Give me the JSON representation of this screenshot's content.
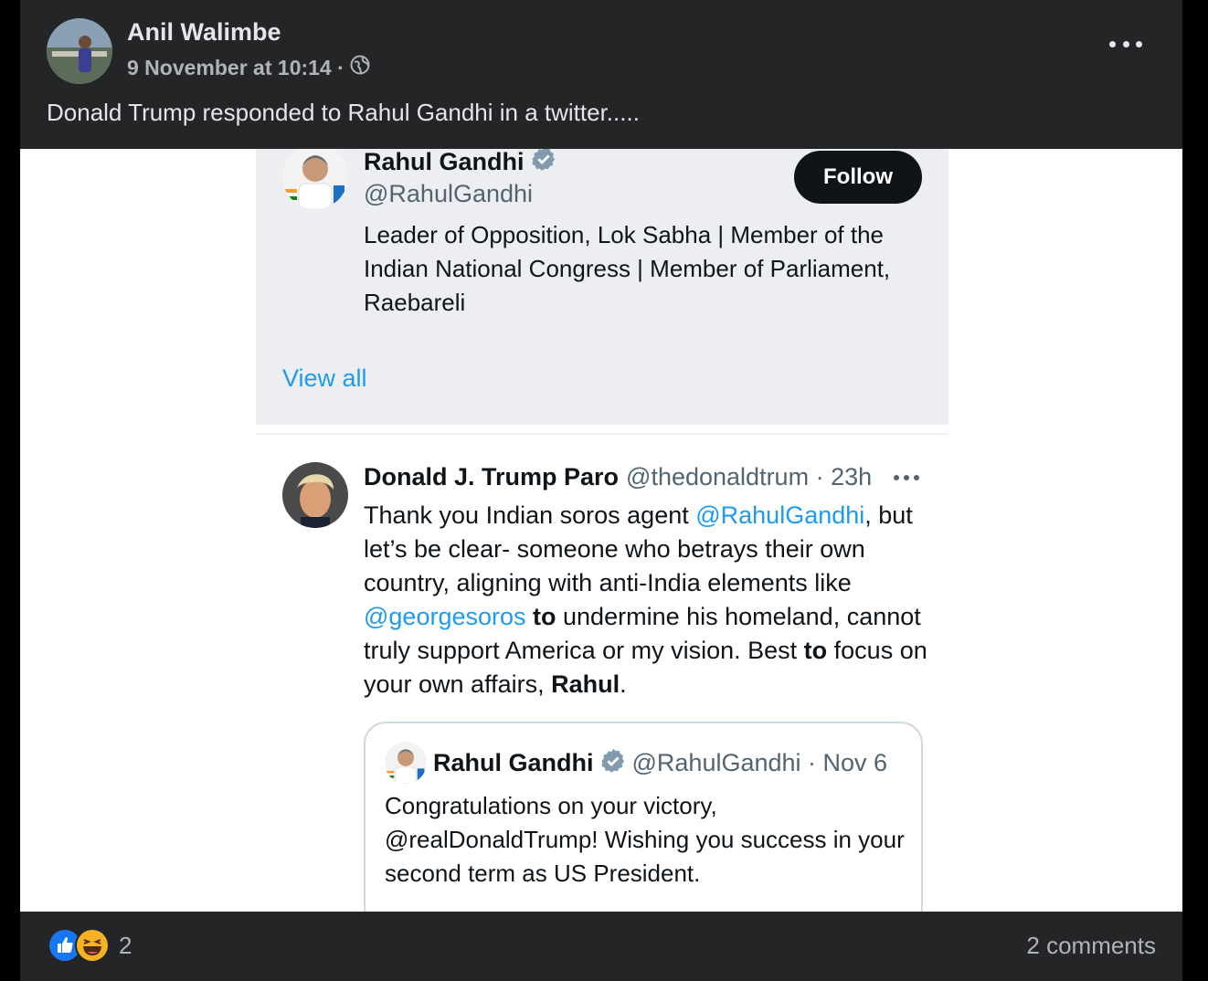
{
  "post": {
    "author": "Anil Walimbe",
    "timestamp": "9 November at 10:14 ·",
    "audience_icon": "globe-icon",
    "text": "Donald Trump responded to Rahul Gandhi in a twitter....."
  },
  "profile_card": {
    "name": "Rahul Gandhi",
    "handle": "@RahulGandhi",
    "follow_label": "Follow",
    "bio": "Leader of Opposition, Lok Sabha | Member of the Indian National Congress | Member of Parliament, Raebareli",
    "view_all": "View all"
  },
  "tweet": {
    "name": "Donald J. Trump Paro",
    "handle_time": "@thedonaldtrum · 23h",
    "body": {
      "p1": "Thank you Indian soros agent ",
      "m1": "@RahulGandhi",
      "p2": ", but let’s be clear- someone who betrays their own country, aligning with anti-India elements like ",
      "m2": "@georgesoros",
      "b1": " to",
      "p3": " undermine his homeland, cannot truly support America or my vision. Best ",
      "b2": "to",
      "p4": " focus on your own affairs, ",
      "b3": "Rahul",
      "p5": "."
    }
  },
  "quote": {
    "name": "Rahul Gandhi",
    "handle_time": "@RahulGandhi · Nov 6",
    "text": "Congratulations on your victory, @realDonaldTrump! Wishing you success in your second term as US President."
  },
  "footer": {
    "reaction_icons": [
      "like-icon",
      "haha-icon"
    ],
    "reaction_count": "2",
    "comments": "2 comments"
  },
  "colors": {
    "fb_bg": "#242526",
    "link_blue": "#1d9bf0",
    "verified": "#829aab"
  }
}
